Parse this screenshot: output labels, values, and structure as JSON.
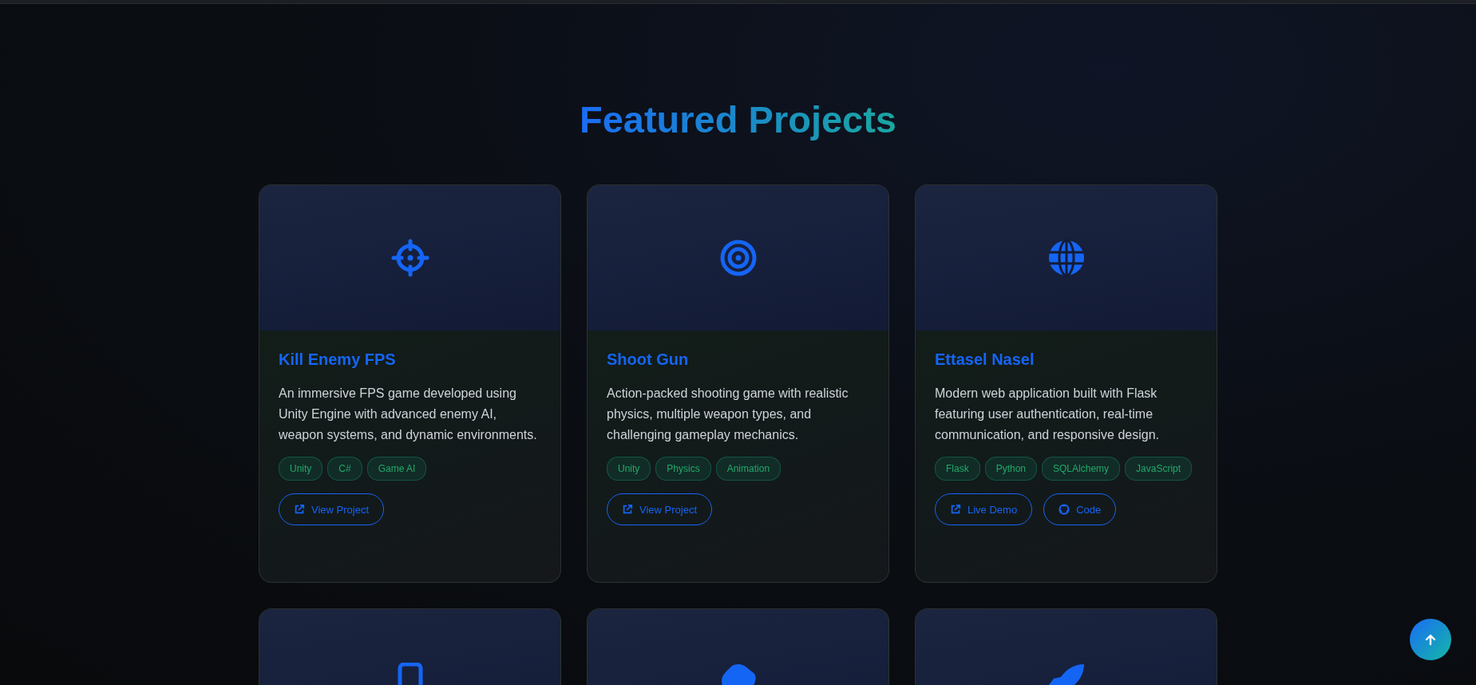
{
  "section": {
    "title": "Featured Projects"
  },
  "projects": [
    {
      "kind": "crosshairs",
      "title": "Kill Enemy FPS",
      "description": "An immersive FPS game developed using Unity Engine with advanced enemy AI, weapon systems, and dynamic environments.",
      "tags": [
        "Unity",
        "C#",
        "Game AI"
      ],
      "links": [
        {
          "kind": "external",
          "label": "View Project"
        }
      ]
    },
    {
      "kind": "bullseye",
      "title": "Shoot Gun",
      "description": "Action-packed shooting game with realistic physics, multiple weapon types, and challenging gameplay mechanics.",
      "tags": [
        "Unity",
        "Physics",
        "Animation"
      ],
      "links": [
        {
          "kind": "external",
          "label": "View Project"
        }
      ]
    },
    {
      "kind": "globe",
      "title": "Ettasel Nasel",
      "description": "Modern web application built with Flask featuring user authentication, real-time communication, and responsive design.",
      "tags": [
        "Flask",
        "Python",
        "SQLAlchemy",
        "JavaScript"
      ],
      "links": [
        {
          "kind": "external",
          "label": "Live Demo"
        },
        {
          "kind": "repo",
          "label": "Code"
        }
      ]
    },
    {
      "kind": "mobile"
    },
    {
      "kind": "blob"
    },
    {
      "kind": "rocket"
    }
  ]
}
